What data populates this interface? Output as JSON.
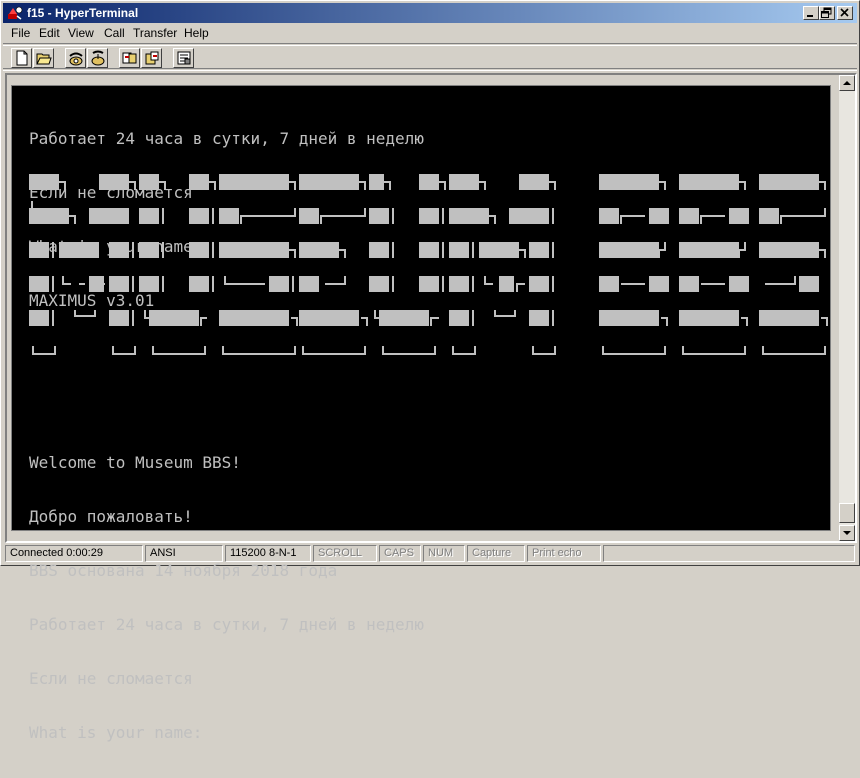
{
  "window": {
    "title": "f15 - HyperTerminal",
    "accent": "#0a246a"
  },
  "menu": {
    "items": [
      {
        "label": "File"
      },
      {
        "label": "Edit"
      },
      {
        "label": "View"
      },
      {
        "label": "Call"
      },
      {
        "label": "Transfer"
      },
      {
        "label": "Help"
      }
    ]
  },
  "toolbar": {
    "icons": [
      "new-icon",
      "open-icon",
      "call-icon",
      "disconnect-icon",
      "send-icon",
      "receive-icon",
      "properties-icon"
    ]
  },
  "terminal": {
    "top_lines": [
      "Работает 24 часа в сутки, 7 дней в неделю",
      "Если не сломается",
      "What is your name:",
      "MAXIMUS v3.01"
    ],
    "bottom_lines": [
      "Welcome to Museum BBS!",
      "Добро пожаловать!",
      "BBS основана 14 ноября 2018 года",
      "Работает 24 часа в сутки, 7 дней в неделю",
      "Если не сломается",
      "What is your name:"
    ],
    "fg_color": "#c0c0c0",
    "bg_color": "#000000"
  },
  "status": {
    "connected": "Connected 0:00:29",
    "emulation": "ANSI",
    "settings": "115200 8-N-1",
    "scroll": "SCROLL",
    "caps": "CAPS",
    "num": "NUM",
    "capture": "Capture",
    "print_echo": "Print echo"
  }
}
